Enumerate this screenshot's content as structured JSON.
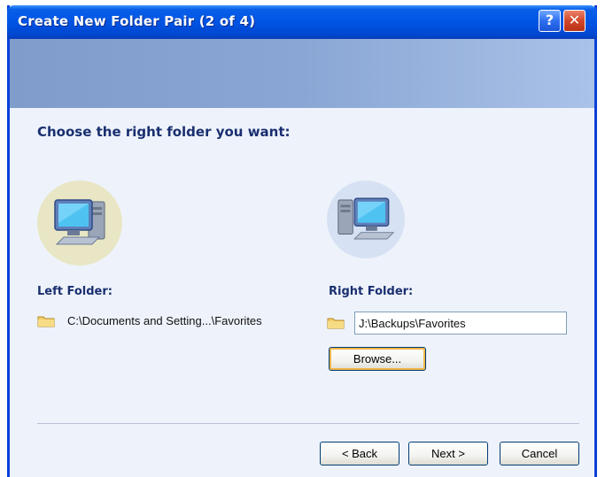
{
  "window": {
    "title": "Create New Folder Pair (2 of 4)",
    "help_glyph": "?",
    "close_glyph": "✕"
  },
  "main": {
    "heading": "Choose the right folder you want:",
    "left": {
      "label": "Left Folder:",
      "path": "C:\\Documents and Setting...\\Favorites"
    },
    "right": {
      "label": "Right Folder:",
      "path": "J:\\Backups\\Favorites",
      "browse_label": "Browse..."
    }
  },
  "footer": {
    "back_label": "< Back",
    "next_label": "Next >",
    "cancel_label": "Cancel"
  },
  "colors": {
    "title_bar": "#0054e3",
    "banner": "#8aa6d4",
    "heading_text": "#1a2f70",
    "content_bg": "#eef3fb"
  },
  "icons": [
    "help-icon",
    "close-icon",
    "computer-icon",
    "folder-icon"
  ]
}
